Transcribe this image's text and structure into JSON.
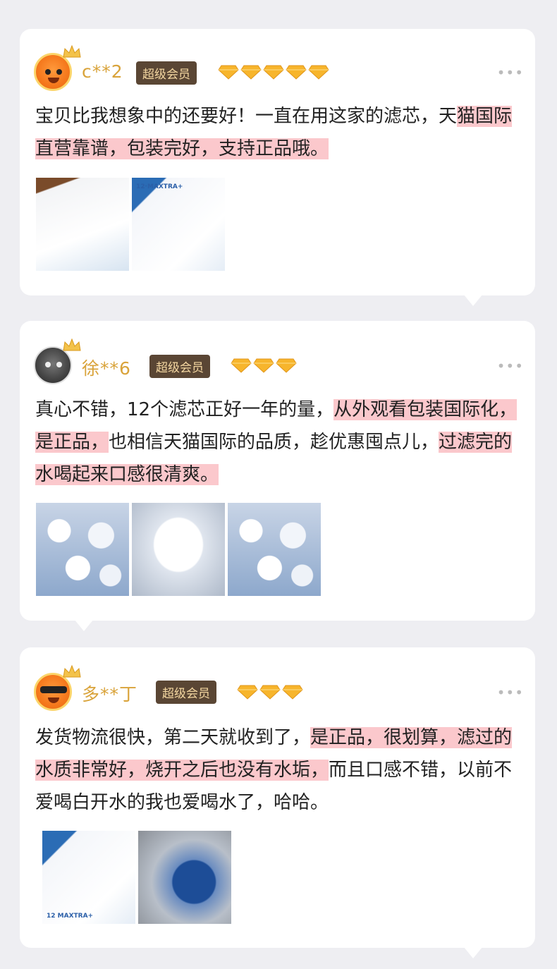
{
  "reviews": [
    {
      "name": "c**2",
      "badge": "超级会员",
      "diamonds": 5,
      "more": "•••",
      "text_parts": [
        {
          "t": "宝贝比我想象中的还要好！一直在用这家的滤芯，天",
          "hl": false
        },
        {
          "t": "猫国际直营靠谱，包装完好，支持正品哦。",
          "hl": true
        }
      ],
      "photos": [
        "box-front-photo",
        "box-maxtra-photo"
      ],
      "photo_labels": [
        "",
        "12·MAXTRA+"
      ],
      "avatar": "orange-mascot"
    },
    {
      "name": "徐**6",
      "badge": "超级会员",
      "diamonds": 3,
      "more": "•••",
      "text_parts": [
        {
          "t": "真心不错，12个滤芯正好一年的量，",
          "hl": false
        },
        {
          "t": "从外观看包装国际化，是正品，",
          "hl": true
        },
        {
          "t": "也相信天猫国际的品质，趁优惠囤点儿，",
          "hl": false
        },
        {
          "t": "过滤完的水喝起来口感很清爽。",
          "hl": true
        }
      ],
      "photos": [
        "filter-pile-photo",
        "filter-cartridge-photo",
        "filter-pile-photo"
      ],
      "photo_labels": [
        "",
        "",
        ""
      ],
      "avatar": "dark-mascot"
    },
    {
      "name": "多**丁",
      "badge": "超级会员",
      "diamonds": 3,
      "more": "•••",
      "text_parts": [
        {
          "t": "发货物流很快，第二天就收到了，",
          "hl": false
        },
        {
          "t": "是正品，很划算，滤过的水质非常好，烧开之后也没有水垢，",
          "hl": true
        },
        {
          "t": "而且口感不错，以前不爱喝白开水的我也爱喝水了，哈哈。",
          "hl": false
        }
      ],
      "photos": [
        "box-maxtra-photo",
        "filter-in-pitcher-photo"
      ],
      "photo_labels": [
        "12 MAXTRA+",
        ""
      ],
      "avatar": "orange-mascot-masked"
    }
  ],
  "colors": {
    "name": "#d9a33a",
    "badge_bg": "#5a4634",
    "badge_text": "#f4d7a1",
    "highlight": "#fbc8cc",
    "diamond": "#f7b52c"
  }
}
